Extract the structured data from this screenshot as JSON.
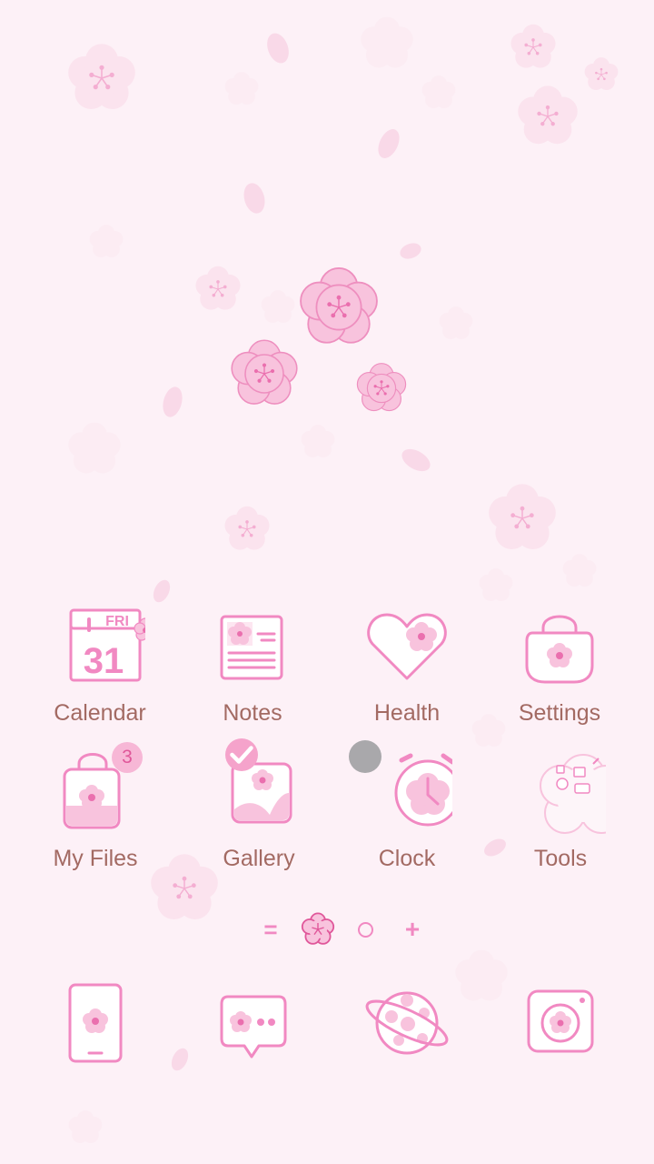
{
  "colors": {
    "background": "#fdf1f7",
    "accent": "#f189c2",
    "label": "#a36a63",
    "badge_bg": "#f7b7d6",
    "badge_text": "#e0579a"
  },
  "apps": [
    {
      "label": "Calendar",
      "icon": "calendar-icon",
      "day": "FRI",
      "date": "31"
    },
    {
      "label": "Notes",
      "icon": "notes-icon"
    },
    {
      "label": "Health",
      "icon": "heart-icon"
    },
    {
      "label": "Settings",
      "icon": "settings-bag-icon"
    },
    {
      "label": "My Files",
      "icon": "folder-bag-icon",
      "badge": "3"
    },
    {
      "label": "Gallery",
      "icon": "gallery-icon",
      "selected": true
    },
    {
      "label": "Clock",
      "icon": "alarm-clock-icon"
    },
    {
      "label": "Tools",
      "icon": "tools-folder-icon"
    }
  ],
  "page_indicator": {
    "items": [
      "menu-lines-icon",
      "flower-home-icon",
      "page-dot-icon",
      "add-page-icon"
    ],
    "menu_glyph": "=",
    "add_glyph": "+",
    "current": "flower-home-icon"
  },
  "dock": [
    {
      "icon": "phone-icon"
    },
    {
      "icon": "messages-icon"
    },
    {
      "icon": "internet-planet-icon"
    },
    {
      "icon": "camera-icon"
    }
  ]
}
